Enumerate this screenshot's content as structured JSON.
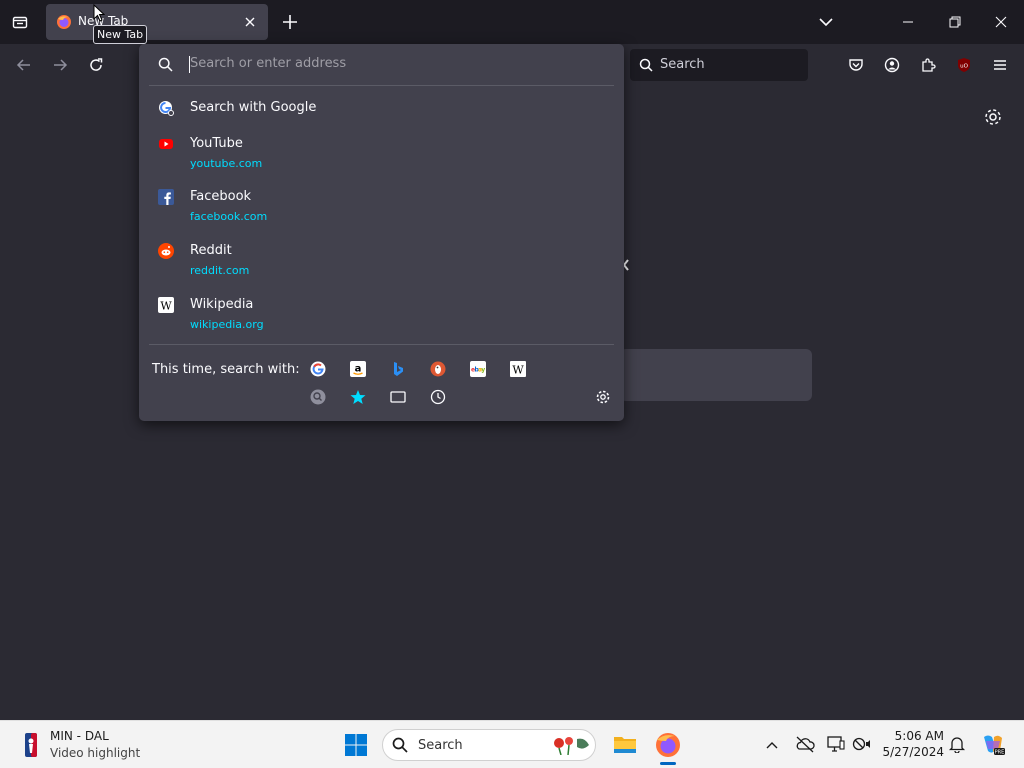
{
  "tab": {
    "title": "New Tab",
    "tooltip": "New Tab"
  },
  "navbar": {
    "search_placeholder": "Search"
  },
  "urlbar": {
    "placeholder": "Search or enter address",
    "results": [
      {
        "kind": "search",
        "title": "Search with Google"
      },
      {
        "kind": "site",
        "title": "YouTube",
        "url": "youtube.com",
        "icon": "youtube-icon"
      },
      {
        "kind": "site",
        "title": "Facebook",
        "url": "facebook.com",
        "icon": "facebook-icon"
      },
      {
        "kind": "site",
        "title": "Reddit",
        "url": "reddit.com",
        "icon": "reddit-icon"
      },
      {
        "kind": "site",
        "title": "Wikipedia",
        "url": "wikipedia.org",
        "icon": "wikipedia-icon"
      }
    ],
    "oneoff_label": "This time, search with:",
    "oneoff_engines": [
      "google-icon",
      "amazon-icon",
      "bing-icon",
      "duckduckgo-icon",
      "ebay-icon",
      "wikipedia-icon"
    ],
    "oneoff_modes": [
      "search-settings-icon",
      "bookmarks-star-icon",
      "tabs-icon",
      "history-icon"
    ]
  },
  "taskbar": {
    "news_title": "MIN - DAL",
    "news_subtitle": "Video highlight",
    "search_placeholder": "Search",
    "time": "5:06 AM",
    "date": "5/27/2024"
  },
  "colors": {
    "chrome_bg": "#1c1b22",
    "toolbar_bg": "#2b2a33",
    "popup_bg": "#42414d",
    "link_cyan": "#00ddff",
    "taskbar_bg": "#f3f3f3"
  }
}
